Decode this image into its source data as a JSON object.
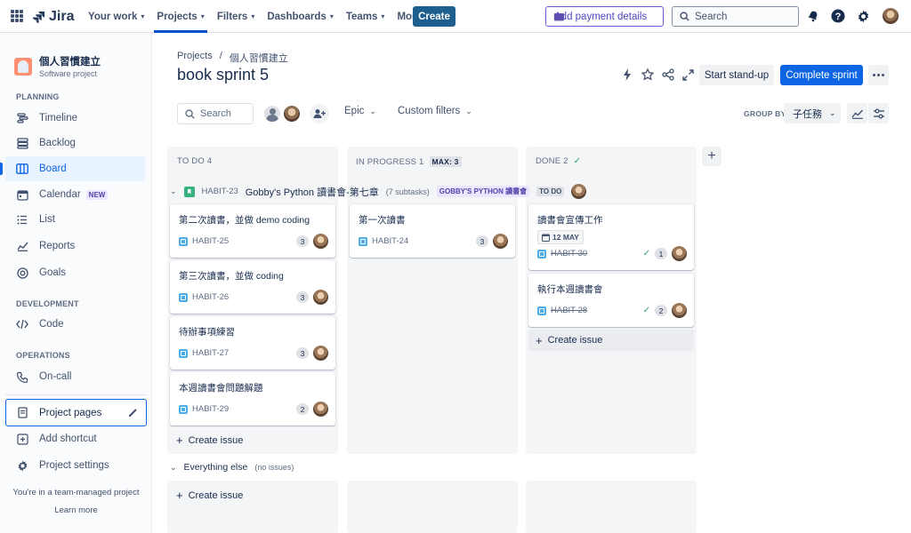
{
  "topnav": {
    "logo": "Jira",
    "menu": [
      "Your work",
      "Projects",
      "Filters",
      "Dashboards",
      "Teams",
      "More"
    ],
    "create": "Create",
    "payment": "Add payment details",
    "search_placeholder": "Search"
  },
  "sidebar": {
    "project_name": "個人習慣建立",
    "project_type": "Software project",
    "planning_label": "PLANNING",
    "planning": [
      {
        "label": "Timeline",
        "icon": "timeline-icon"
      },
      {
        "label": "Backlog",
        "icon": "backlog-icon"
      },
      {
        "label": "Board",
        "icon": "board-icon"
      },
      {
        "label": "Calendar",
        "icon": "calendar-icon",
        "badge": "NEW"
      },
      {
        "label": "List",
        "icon": "list-icon"
      },
      {
        "label": "Reports",
        "icon": "reports-icon"
      },
      {
        "label": "Goals",
        "icon": "goals-icon"
      }
    ],
    "development_label": "DEVELOPMENT",
    "code": "Code",
    "operations_label": "OPERATIONS",
    "oncall": "On-call",
    "project_pages": "Project pages",
    "add_shortcut": "Add shortcut",
    "project_settings": "Project settings",
    "footer_text": "You're in a team-managed project",
    "learn_more": "Learn more"
  },
  "header": {
    "breadcrumb": [
      "Projects",
      "/",
      "個人習慣建立"
    ],
    "title": "book sprint 5",
    "start_standup": "Start stand-up",
    "complete_sprint": "Complete sprint"
  },
  "toolbar": {
    "search_placeholder": "Search",
    "epic": "Epic",
    "custom_filters": "Custom filters",
    "group_by_label": "GROUP BY",
    "group_by_value": "子任務"
  },
  "columns": [
    {
      "title": "TO DO 4"
    },
    {
      "title": "IN PROGRESS 1",
      "max": "MAX: 3"
    },
    {
      "title": "DONE 2"
    }
  ],
  "swimlane": {
    "key": "HABIT-23",
    "title": "Gobby's Python 讀書會-第七章",
    "subtasks": "(7 subtasks)",
    "epic": "GOBBY'S PYTHON 讀書會",
    "status": "TO DO"
  },
  "cards": {
    "todo": [
      {
        "title": "第二次讀書，並做 demo coding",
        "key": "HABIT-25",
        "est": "3"
      },
      {
        "title": "第三次讀書，並做 coding",
        "key": "HABIT-26",
        "est": "3"
      },
      {
        "title": "待辦事項練習",
        "key": "HABIT-27",
        "est": "3"
      },
      {
        "title": "本週讀書會問題解題",
        "key": "HABIT-29",
        "est": "2"
      }
    ],
    "inprogress": [
      {
        "title": "第一次讀書",
        "key": "HABIT-24",
        "est": "3"
      }
    ],
    "done": [
      {
        "title": "讀書會宣傳工作",
        "key": "HABIT-30",
        "est": "1",
        "date": "12 MAY"
      },
      {
        "title": "執行本週讀書會",
        "key": "HABIT-28",
        "est": "2"
      }
    ]
  },
  "create_issue": "Create issue",
  "everything_else": {
    "title": "Everything else",
    "note": "(no issues)"
  },
  "colors": {
    "primary": "#0c66e4",
    "epic_bg": "#eae6ff",
    "epic_fg": "#5243aa",
    "story": "#36b37e",
    "subtask": "#4bade8"
  }
}
